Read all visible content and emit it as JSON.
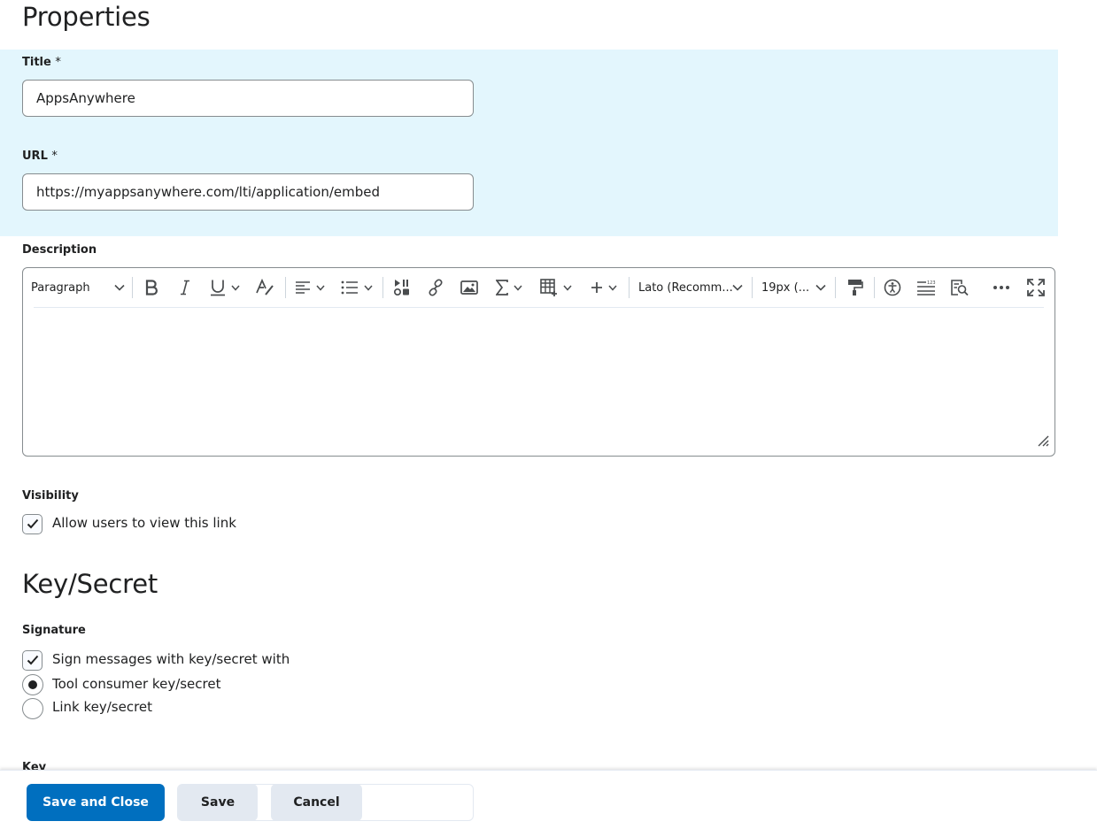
{
  "properties": {
    "heading": "Properties",
    "title_label": "Title",
    "url_label": "URL",
    "required_marker": "*",
    "title_value": "AppsAnywhere",
    "url_value": "https://myappsanywhere.com/lti/application/embed",
    "description_label": "Description"
  },
  "editor": {
    "block_format": "Paragraph",
    "font_family": "Lato (Recomm...",
    "font_size": "19px (...",
    "icons": [
      "bold-icon",
      "italic-icon",
      "underline-icon",
      "text-color-icon",
      "align-icon",
      "list-icon",
      "media-icon",
      "link-icon",
      "image-icon",
      "equation-icon",
      "table-icon",
      "insert-icon",
      "format-painter-icon",
      "accessibility-icon",
      "word-count-icon",
      "preview-icon",
      "more-icon",
      "fullscreen-icon"
    ]
  },
  "visibility": {
    "label": "Visibility",
    "checkbox_label": "Allow users to view this link",
    "checked": true
  },
  "key_secret": {
    "heading": "Key/Secret",
    "signature_label": "Signature",
    "sign_checkbox_label": "Sign messages with key/secret with",
    "sign_checked": true,
    "radio_options": [
      "Tool consumer key/secret",
      "Link key/secret"
    ],
    "selected_radio": "Tool consumer key/secret",
    "key_label": "Key"
  },
  "footer": {
    "save_close_label": "Save and Close",
    "save_label": "Save",
    "cancel_label": "Cancel"
  },
  "colors": {
    "highlight": "#e3f6fd",
    "primary": "#006fbf",
    "secondary": "#e3e9f1",
    "text": "#202122"
  }
}
